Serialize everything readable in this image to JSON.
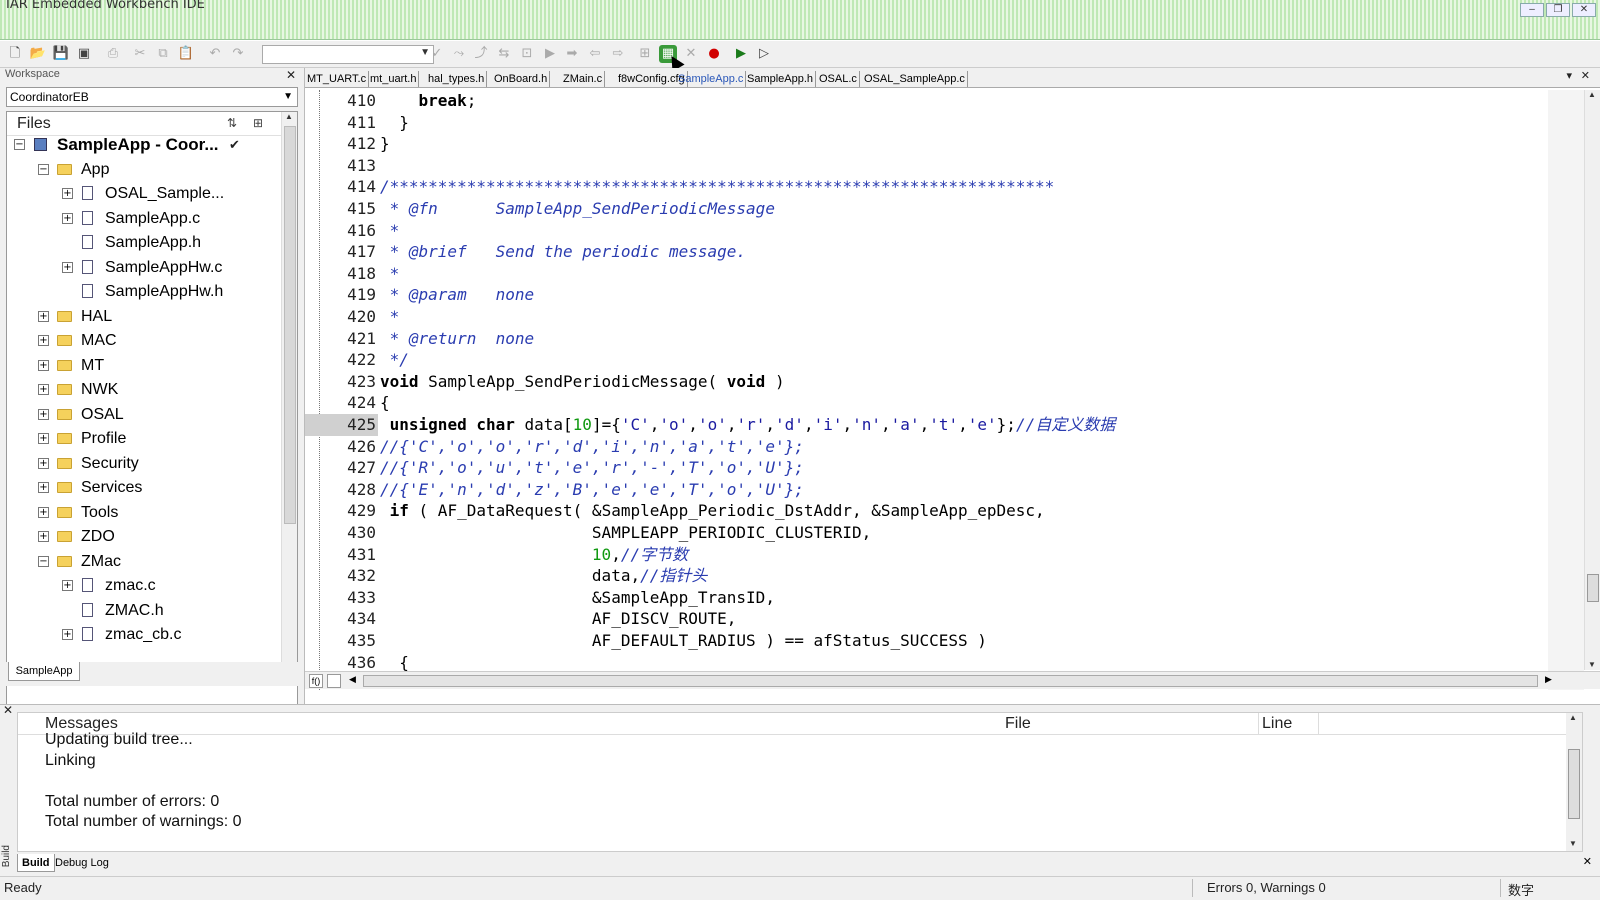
{
  "window": {
    "title": "IAR Embedded Workbench IDE",
    "minimize": "–",
    "restore": "❐",
    "close": "✕"
  },
  "workspace": {
    "title": "Workspace",
    "config": "CoordinatorEB",
    "files_label": "Files",
    "tab": "SampleApp",
    "tree": [
      {
        "label": "SampleApp - Coor...",
        "check": "✔"
      },
      {
        "label": "App"
      },
      {
        "label": "OSAL_Sample..."
      },
      {
        "label": "SampleApp.c"
      },
      {
        "label": "SampleApp.h"
      },
      {
        "label": "SampleAppHw.c"
      },
      {
        "label": "SampleAppHw.h"
      },
      {
        "label": "HAL"
      },
      {
        "label": "MAC"
      },
      {
        "label": "MT"
      },
      {
        "label": "NWK"
      },
      {
        "label": "OSAL"
      },
      {
        "label": "Profile"
      },
      {
        "label": "Security"
      },
      {
        "label": "Services"
      },
      {
        "label": "Tools"
      },
      {
        "label": "ZDO"
      },
      {
        "label": "ZMac"
      },
      {
        "label": "zmac.c"
      },
      {
        "label": "ZMAC.h"
      },
      {
        "label": "zmac_cb.c"
      }
    ]
  },
  "editor": {
    "tabs": [
      "MT_UART.c",
      "mt_uart.h",
      "hal_types.h",
      "OnBoard.h",
      "ZMain.c",
      "f8wConfig.cfg",
      "SampleApp.c",
      "SampleApp.h",
      "OSAL.c",
      "OSAL_SampleApp.c"
    ],
    "active_tab": "SampleApp.c",
    "fn_button": "f()",
    "current_line": "425",
    "lines": [
      {
        "n": "410",
        "text": "    break;"
      },
      {
        "n": "411",
        "text": "  }"
      },
      {
        "n": "412",
        "text": "}"
      },
      {
        "n": "413",
        "text": ""
      },
      {
        "n": "414",
        "text": "/*********************************************************************"
      },
      {
        "n": "415",
        "text": " * @fn      SampleApp_SendPeriodicMessage"
      },
      {
        "n": "416",
        "text": " *"
      },
      {
        "n": "417",
        "text": " * @brief   Send the periodic message."
      },
      {
        "n": "418",
        "text": " *"
      },
      {
        "n": "419",
        "text": " * @param   none"
      },
      {
        "n": "420",
        "text": " *"
      },
      {
        "n": "421",
        "text": " * @return  none"
      },
      {
        "n": "422",
        "text": " */"
      },
      {
        "n": "423",
        "text": "void SampleApp_SendPeriodicMessage( void )"
      },
      {
        "n": "424",
        "text": "{"
      },
      {
        "n": "425",
        "text": " unsigned char data[10]={'C','o','o','r','d','i','n','a','t','e'};//自定义数据"
      },
      {
        "n": "426",
        "text": "//{'C','o','o','r','d','i','n','a','t','e'};"
      },
      {
        "n": "427",
        "text": "//{'R','o','u','t','e','r','-','T','o','U'};"
      },
      {
        "n": "428",
        "text": "//{'E','n','d','z','B','e','e','T','o','U'};"
      },
      {
        "n": "429",
        "text": " if ( AF_DataRequest( &SampleApp_Periodic_DstAddr, &SampleApp_epDesc,"
      },
      {
        "n": "430",
        "text": "                      SAMPLEAPP_PERIODIC_CLUSTERID,"
      },
      {
        "n": "431",
        "text": "                      10,//字节数"
      },
      {
        "n": "432",
        "text": "                      data,//指针头"
      },
      {
        "n": "433",
        "text": "                      &SampleApp_TransID,"
      },
      {
        "n": "434",
        "text": "                      AF_DISCV_ROUTE,"
      },
      {
        "n": "435",
        "text": "                      AF_DEFAULT_RADIUS ) == afStatus_SUCCESS )"
      },
      {
        "n": "436",
        "text": "  {"
      }
    ]
  },
  "messages": {
    "headers": {
      "messages": "Messages",
      "file": "File",
      "line": "Line"
    },
    "lines": [
      "Updating build tree...",
      "Linking",
      "",
      "Total number of errors: 0",
      "Total number of warnings: 0"
    ],
    "side_label": "Build",
    "tabs": [
      "Build",
      "Debug Log"
    ]
  },
  "status": {
    "left": "Ready",
    "right": "Errors 0, Warnings 0",
    "ime": "数字"
  }
}
